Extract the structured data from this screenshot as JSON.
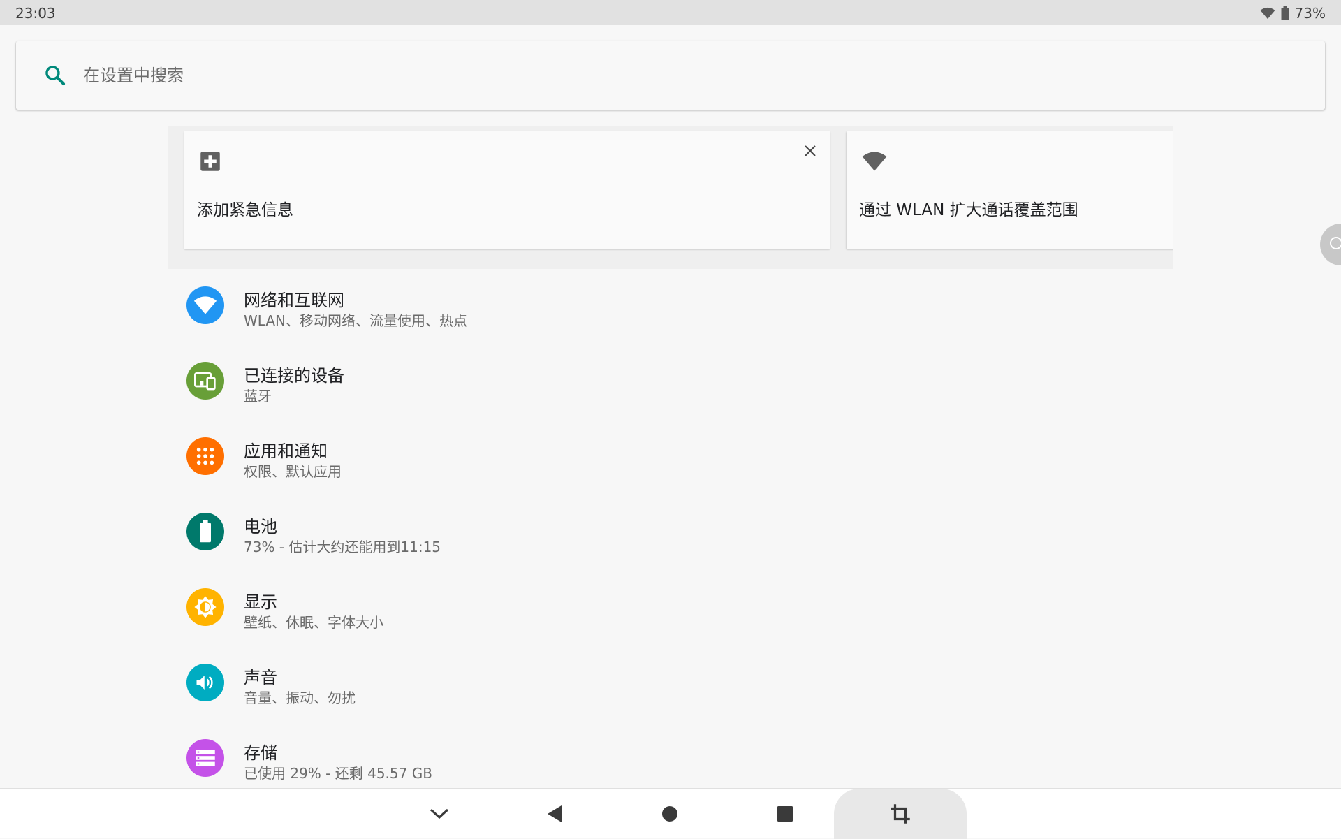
{
  "status_bar": {
    "time": "23:03",
    "battery": "73%"
  },
  "search": {
    "placeholder": "在设置中搜索",
    "icon": "search-icon"
  },
  "suggestions": [
    {
      "title": "添加紧急信息",
      "icon": "medical-plus-icon",
      "dismissible": true
    },
    {
      "title": "通过 WLAN 扩大通话覆盖范围",
      "icon": "wifi-icon",
      "dismissible": false
    }
  ],
  "settings": [
    {
      "title": "网络和互联网",
      "summary": "WLAN、移动网络、流量使用、热点",
      "icon": "wifi-icon",
      "color": "#2196F3"
    },
    {
      "title": "已连接的设备",
      "summary": "蓝牙",
      "icon": "devices-icon",
      "color": "#689F38"
    },
    {
      "title": "应用和通知",
      "summary": "权限、默认应用",
      "icon": "apps-icon",
      "color": "#FF6F00"
    },
    {
      "title": "电池",
      "summary": "73% - 估计大约还能用到11:15",
      "icon": "battery-icon",
      "color": "#00796B"
    },
    {
      "title": "显示",
      "summary": "壁纸、休眠、字体大小",
      "icon": "brightness-icon",
      "color": "#FFB300"
    },
    {
      "title": "声音",
      "summary": "音量、振动、勿扰",
      "icon": "volume-icon",
      "color": "#00ACC1"
    },
    {
      "title": "存储",
      "summary": "已使用 29% - 还剩 45.57 GB",
      "icon": "storage-icon",
      "color": "#C452E8"
    }
  ],
  "nav_bar": [
    "chevron-down-icon",
    "back-icon",
    "home-icon",
    "recents-icon",
    "crop-icon"
  ]
}
